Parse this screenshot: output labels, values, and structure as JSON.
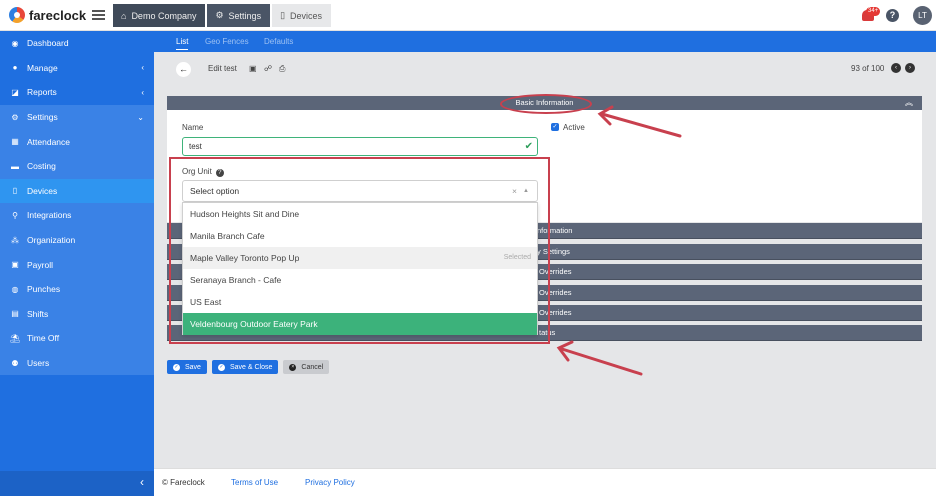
{
  "app": {
    "logo_text": "fareclock"
  },
  "breadcrumbs": [
    {
      "icon": "home-icon",
      "label": "Demo Company"
    },
    {
      "icon": "gear-icon",
      "label": "Settings"
    },
    {
      "icon": "device-icon",
      "label": "Devices"
    }
  ],
  "header": {
    "notification_count": "34+",
    "help": "?",
    "avatar_initials": "LT"
  },
  "sidebar": {
    "items": [
      {
        "label": "Dashboard",
        "icon": "dashboard-icon",
        "chevron": ""
      },
      {
        "label": "Manage",
        "icon": "user-icon",
        "chevron": "‹"
      },
      {
        "label": "Reports",
        "icon": "chart-icon",
        "chevron": "‹"
      },
      {
        "label": "Settings",
        "icon": "gear-icon",
        "chevron": "⌄"
      },
      {
        "label": "Attendance",
        "icon": "attendance-icon",
        "chevron": ""
      },
      {
        "label": "Costing",
        "icon": "folder-icon",
        "chevron": ""
      },
      {
        "label": "Devices",
        "icon": "device-icon",
        "chevron": ""
      },
      {
        "label": "Integrations",
        "icon": "plug-icon",
        "chevron": ""
      },
      {
        "label": "Organization",
        "icon": "org-icon",
        "chevron": ""
      },
      {
        "label": "Payroll",
        "icon": "money-icon",
        "chevron": ""
      },
      {
        "label": "Punches",
        "icon": "punch-icon",
        "chevron": ""
      },
      {
        "label": "Shifts",
        "icon": "shift-icon",
        "chevron": ""
      },
      {
        "label": "Time Off",
        "icon": "timeoff-icon",
        "chevron": ""
      },
      {
        "label": "Users",
        "icon": "users-icon",
        "chevron": ""
      }
    ],
    "collapse": "‹"
  },
  "tabs": [
    "List",
    "Geo Fences",
    "Defaults"
  ],
  "toolbar": {
    "back": "←",
    "title": "Edit test",
    "pager_text": "93 of 100",
    "prev": "‹",
    "next": "›"
  },
  "section": {
    "title": "Basic Information"
  },
  "form": {
    "name_label": "Name",
    "name_value": "test",
    "active_label": "Active",
    "active_checked": true,
    "org_unit_label": "Org Unit",
    "org_unit_placeholder": "Select option",
    "clear": "×",
    "caret": "▲"
  },
  "collapsed_sections": [
    "nformation",
    "y Settings",
    "Overrides",
    "Overrides",
    "Overrides",
    "tatus"
  ],
  "dropdown": {
    "options": [
      "Hudson Heights Sit and Dine",
      "Manila Branch Cafe",
      "Maple Valley Toronto Pop Up",
      "Seranaya Branch - Cafe",
      "US East",
      "Veldenbourg Outdoor Eatery Park"
    ],
    "selected_index": 2,
    "highlighted_index": 5,
    "selected_text": "Selected"
  },
  "buttons": {
    "save": "Save",
    "save_close": "Save & Close",
    "cancel": "Cancel"
  },
  "footer": {
    "copyright": "© Fareclock",
    "terms": "Terms of Use",
    "privacy": "Privacy Policy"
  },
  "colors": {
    "primary": "#1f6fe0",
    "section_header": "#5b6578",
    "highlight": "#3cb27b",
    "annotation": "#c8404e"
  }
}
